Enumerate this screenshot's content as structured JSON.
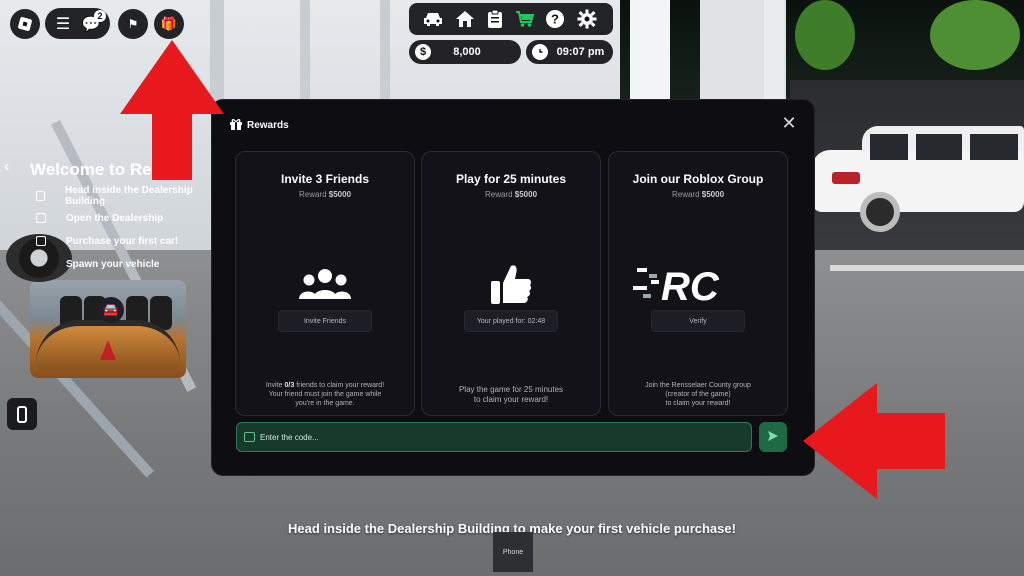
{
  "hud": {
    "notification_count": "2",
    "money": "8,000",
    "money_icon": "$",
    "clock": "09:07 pm",
    "top_icons": [
      "car-icon",
      "home-icon",
      "clipboard-icon",
      "shop-cart-icon",
      "help-icon",
      "settings-icon"
    ],
    "accent_cart": "#22c55e"
  },
  "quest": {
    "title": "Welcome to Re",
    "items": [
      "Head inside the Dealership Building",
      "Open the Dealership",
      "Purchase your first car!",
      "Spawn your vehicle"
    ]
  },
  "modal": {
    "title": "Rewards",
    "cards": [
      {
        "title": "Invite 3 Friends",
        "reward_prefix": "Reward",
        "reward": "$5000",
        "button": "Invite Friends",
        "desc_prefix": "Invite",
        "desc_count": "0/3",
        "desc_rest": "friends to claim your reward!",
        "desc_line2": "Your friend must join the game while",
        "desc_line3": "you're in the game."
      },
      {
        "title": "Play for 25 minutes",
        "reward_prefix": "Reward",
        "reward": "$5000",
        "button": "Your played for: 02:48",
        "desc_line1": "Play the game for 25 minutes",
        "desc_line2": "to claim your reward!"
      },
      {
        "title": "Join our Roblox Group",
        "reward_prefix": "Reward",
        "reward": "$5000",
        "logo_text": "RC",
        "button": "Verify",
        "desc_line1": "Join the Rensselaer County group",
        "desc_line2": "(creator of the game)",
        "desc_line3": "to claim your reward!"
      }
    ],
    "code_placeholder": "Enter the code...",
    "accent_green": "#1f6a45"
  },
  "bottom": {
    "prompt": "Head inside the Dealership Building to make your first vehicle purchase!",
    "phone_tab": "Phone"
  },
  "colors": {
    "arrow": "#e8191d",
    "panel": "#0d0d12"
  }
}
